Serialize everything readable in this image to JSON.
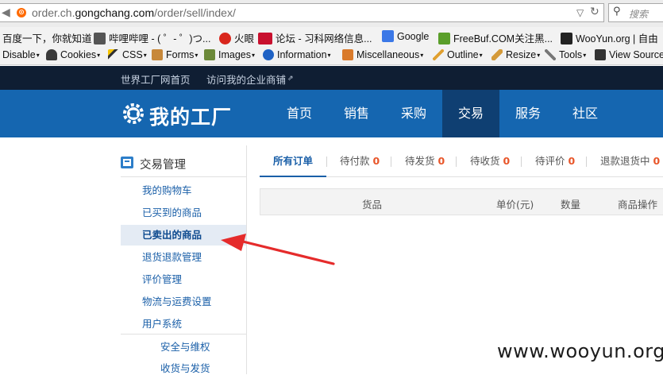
{
  "browser": {
    "url_prefix": "order.ch.",
    "url_domain": "gongchang.com",
    "url_path": "/order/sell/index/",
    "search_placeholder": "搜索",
    "bookmarks": [
      {
        "label": "百度一下，你就知道",
        "icon": "none",
        "color": ""
      },
      {
        "label": "哔哩哔哩 - ( ゜- ゜)つ...",
        "icon": "bilibili-tv-icon",
        "color": "#555555"
      },
      {
        "label": "火眼",
        "icon": "target-icon",
        "color": "#d9261c"
      },
      {
        "label": "论坛 - 习科网络信息...",
        "icon": "slc-logo-icon",
        "color": "#c8102e"
      },
      {
        "label": "Google",
        "icon": "google-g-icon",
        "color": "#3b78e7"
      },
      {
        "label": "FreeBuf.COM关注黑...",
        "icon": "freebuf-f-icon",
        "color": "#5a9e2a"
      },
      {
        "label": "WooYun.org | 自由",
        "icon": "wooyun-icon",
        "color": "#222222"
      }
    ],
    "dev_toolbar": [
      {
        "label": "Disable",
        "icon": "none"
      },
      {
        "label": "Cookies",
        "icon": "user-silhouette-icon"
      },
      {
        "label": "CSS",
        "icon": "magic-wand-icon"
      },
      {
        "label": "Forms",
        "icon": "clipboard-icon"
      },
      {
        "label": "Images",
        "icon": "image-icon"
      },
      {
        "label": "Information",
        "icon": "info-icon"
      },
      {
        "label": "Miscellaneous",
        "icon": "notebook-icon"
      },
      {
        "label": "Outline",
        "icon": "pencil-icon"
      },
      {
        "label": "Resize",
        "icon": "ruler-icon"
      },
      {
        "label": "Tools",
        "icon": "wrench-icon"
      },
      {
        "label": "View Source",
        "icon": "terminal-icon"
      }
    ]
  },
  "topbar": {
    "home_link": "世界工厂网首页",
    "shop_link": "访问我的企业商铺"
  },
  "nav": {
    "logo_text": "我的工厂",
    "items": [
      "首页",
      "销售",
      "采购",
      "交易",
      "服务",
      "社区"
    ],
    "active_index": 3
  },
  "sidebar": {
    "title": "交易管理",
    "items": [
      "我的购物车",
      "已买到的商品",
      "已卖出的商品",
      "退货退款管理",
      "评价管理",
      "物流与运费设置",
      "用户系统"
    ],
    "active_index": 2,
    "sub_items": [
      "安全与维权",
      "收货与发货"
    ]
  },
  "tabs": [
    {
      "label": "所有订单",
      "count": ""
    },
    {
      "label": "待付款",
      "count": "0"
    },
    {
      "label": "待发货",
      "count": "0"
    },
    {
      "label": "待收货",
      "count": "0"
    },
    {
      "label": "待评价",
      "count": "0"
    },
    {
      "label": "退款退货中",
      "count": "0"
    }
  ],
  "table_headers": [
    "货品",
    "单价(元)",
    "数量",
    "商品操作"
  ],
  "annotation": {
    "arrow_color": "#e52b2b"
  },
  "watermark": "www.wooyun.org",
  "colors": {
    "nav_blue": "#1566b0",
    "nav_active": "#0f3f72",
    "topbar": "#0f1e33",
    "link_blue": "#1a5fa8",
    "count_orange": "#e8562a"
  }
}
